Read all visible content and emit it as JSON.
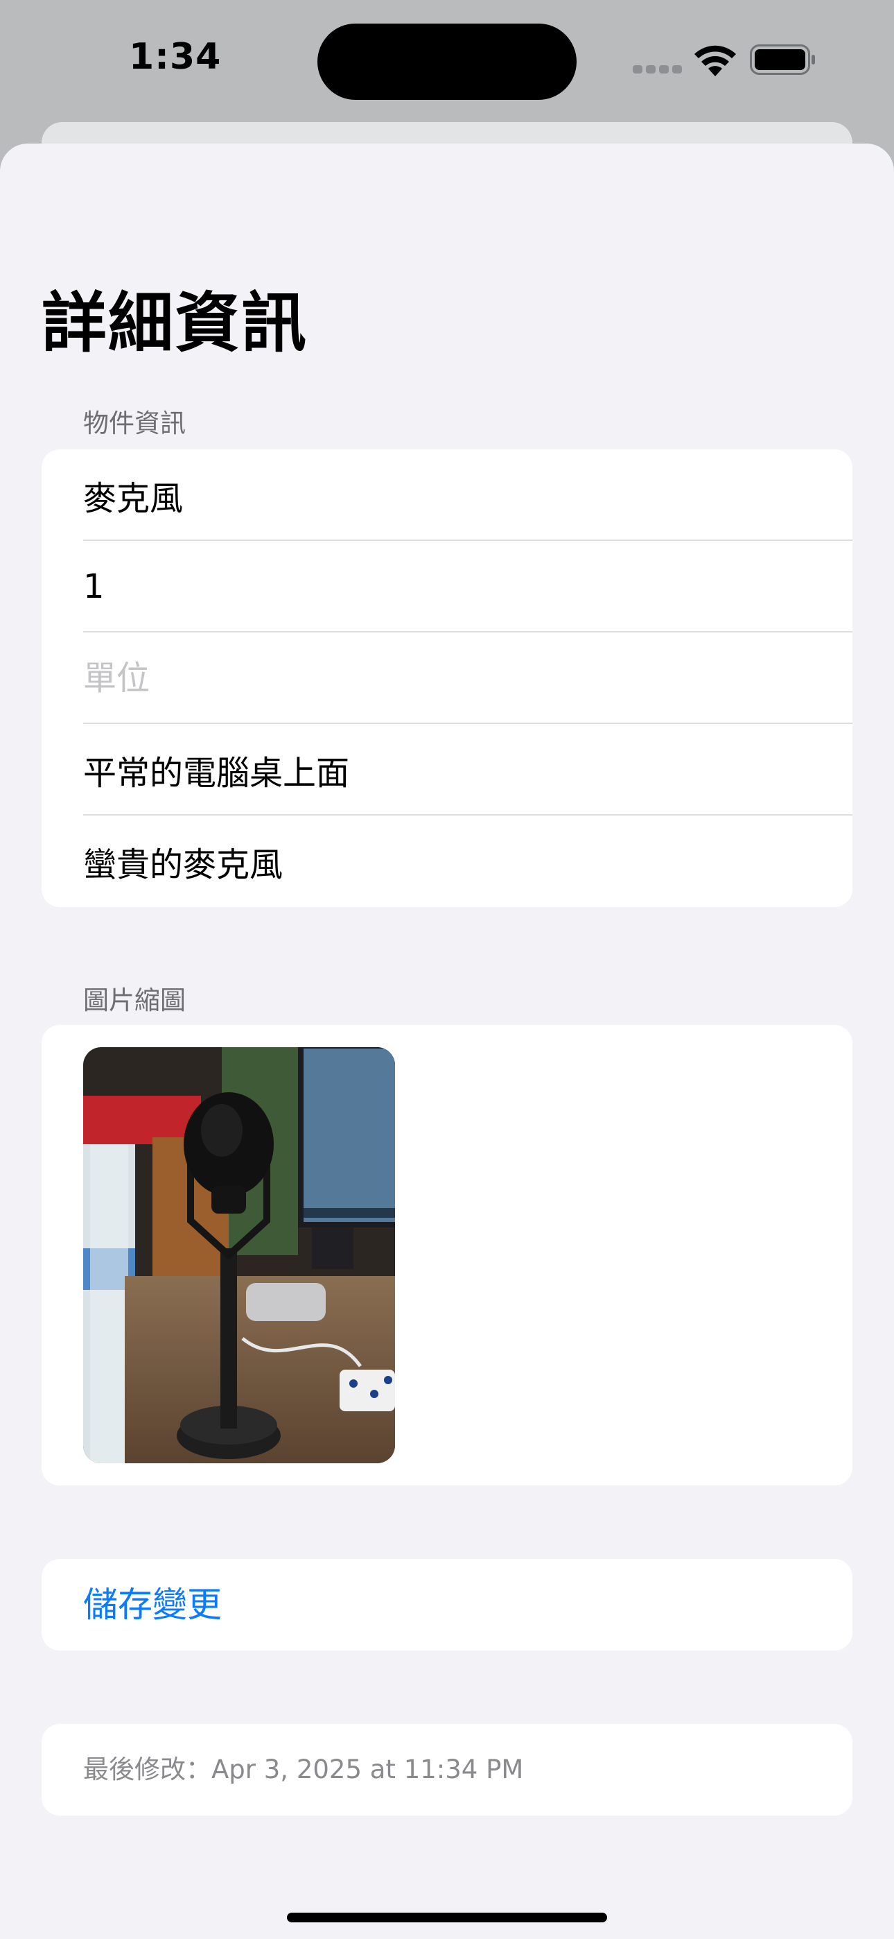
{
  "status_bar": {
    "time": "1:34"
  },
  "page": {
    "title": "詳細資訊"
  },
  "item_info": {
    "header": "物件資訊",
    "name_value": "麥克風",
    "quantity_value": "1",
    "unit_placeholder": "單位",
    "location_value": "平常的電腦桌上面",
    "note_value": "蠻貴的麥克風"
  },
  "thumbnail": {
    "header": "圖片縮圖"
  },
  "actions": {
    "save_label": "儲存變更"
  },
  "footer": {
    "last_modified": "最後修改：Apr 3, 2025 at 11:34 PM"
  },
  "colors": {
    "accent": "#0a7aff",
    "background": "#f2f2f7",
    "card": "#ffffff"
  }
}
